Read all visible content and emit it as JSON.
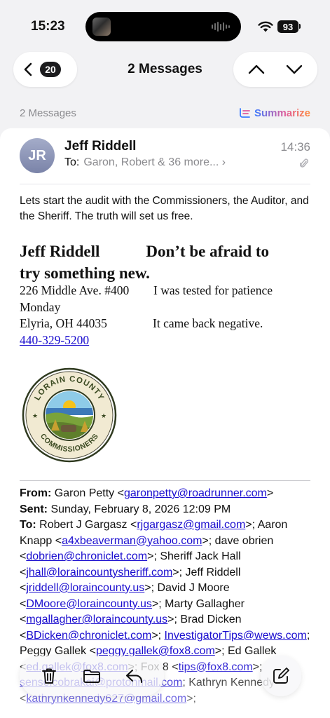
{
  "status_bar": {
    "time": "15:23",
    "battery": "93"
  },
  "nav": {
    "back_count": "20",
    "title": "2 Messages"
  },
  "thread": {
    "count_label": "2 Messages",
    "summarize_label": "Summarize"
  },
  "message": {
    "avatar_initials": "JR",
    "sender": "Jeff Riddell",
    "to_label": "To:",
    "to_value": "Garon, Robert & 36 more... ›",
    "time": "14:36",
    "body": "Lets start the audit with the Commissioners, the Auditor, and the Sheriff.  The truth will set us free."
  },
  "signature": {
    "name": "Jeff Riddell",
    "motto_part1": "Don’t be afraid to",
    "motto_part2": "try something new.",
    "address1": "226 Middle Ave. #400",
    "quote1": "I was tested for patience",
    "quote2": "Monday",
    "address2": "Elyria, OH 44035",
    "quote3": "It came back negative.",
    "phone": "440-329-5200",
    "seal_alt": "LORAIN COUNTY COMMISSIONERS"
  },
  "forwarded": {
    "from_label": "From:",
    "from_name": "Garon Petty <",
    "from_email": "garonpetty@roadrunner.com",
    "sent_label": "Sent:",
    "sent_value": "Sunday, February 8, 2026 12:09 PM",
    "to_label": "To:",
    "recipients": [
      {
        "name": "Robert J Gargasz",
        "email": "rjgargasz@gmail.com"
      },
      {
        "name": "Aaron Knapp",
        "email": "a4xbeaverman@yahoo.com"
      },
      {
        "name": "dave obrien",
        "email": "dobrien@chroniclet.com"
      },
      {
        "name": "Sheriff Jack Hall",
        "email": "jhall@loraincountysheriff.com"
      },
      {
        "name": "Jeff Riddell",
        "email": "jriddell@loraincounty.us"
      },
      {
        "name": "David J Moore",
        "email": "DMoore@loraincounty.us"
      },
      {
        "name": "Marty Gallagher",
        "email": "mgallagher@loraincounty.us"
      },
      {
        "name": "Brad Dicken",
        "email": "BDicken@chroniclet.com"
      },
      {
        "name": "",
        "email": "InvestigatorTips@wews.com"
      },
      {
        "name": "Peggy Gallek",
        "email": "peggy.gallek@fox8.com"
      },
      {
        "name": "Ed Gallek",
        "email": "ed.gallek@fox8.com"
      },
      {
        "name": "Fox 8",
        "email": "tips@fox8.com"
      },
      {
        "name": "",
        "email": "senseicobrakai@protonmail.com"
      },
      {
        "name": "Kathryn Kennedy",
        "email": "kathrynkennedy627@gmail.com"
      }
    ]
  },
  "toolbar": {
    "trash_icon": "trash-icon",
    "folder_icon": "folder-icon",
    "reply_icon": "reply-icon",
    "compose_icon": "compose-icon"
  },
  "colors": {
    "link": "#1a0dcf",
    "avatar": "#8d95b8",
    "summarize_start": "#3a7bff",
    "summarize_end": "#ff8a3a"
  }
}
